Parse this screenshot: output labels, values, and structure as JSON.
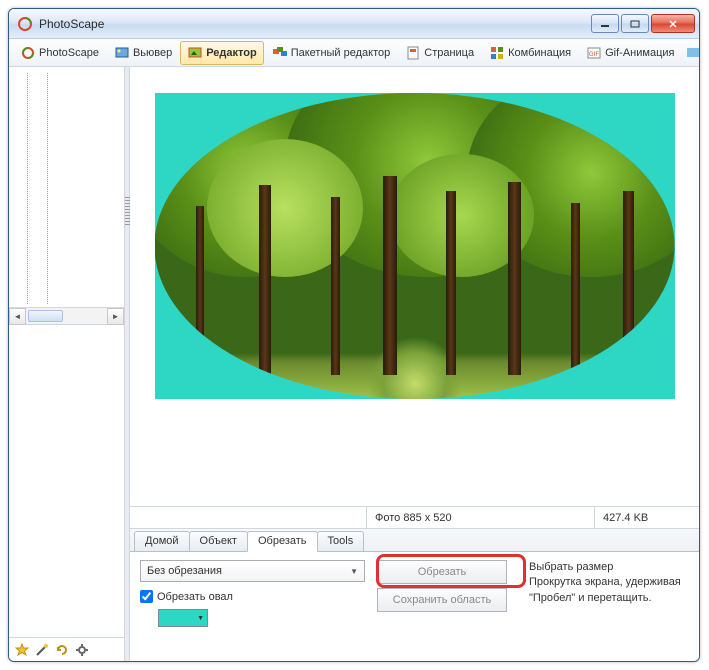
{
  "window": {
    "title": "PhotoScape"
  },
  "toolbar": {
    "tabs": [
      "PhotoScape",
      "Вьювер",
      "Редактор",
      "Пакетный редактор",
      "Страница",
      "Комбинация",
      "Gif-Анимация"
    ],
    "active_index": 2
  },
  "info": {
    "photo_label": "Фото 885 x 520",
    "size_label": "427.4 KB"
  },
  "subtabs": {
    "items": [
      "Домой",
      "Объект",
      "Обрезать",
      "Tools"
    ],
    "active_index": 2
  },
  "crop_panel": {
    "mode_label": "Без обрезания",
    "oval_check_label": "Обрезать овал",
    "oval_checked": true,
    "crop_color": "#2ed6c4",
    "crop_btn": "Обрезать",
    "save_btn": "Сохранить область",
    "hint_line1": "Выбрать размер",
    "hint_line2": "Прокрутка экрана, удерживая",
    "hint_line3": "\"Пробел\" и перетащить."
  },
  "icons": {
    "app": "photoscape-icon",
    "star": "star-icon",
    "wand": "wand-icon",
    "refresh": "refresh-icon",
    "gear": "gear-icon"
  }
}
